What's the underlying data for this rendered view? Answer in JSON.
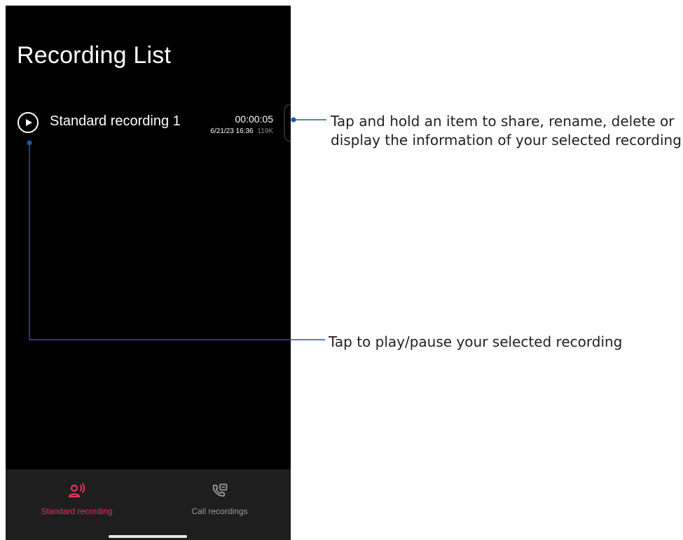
{
  "app": {
    "title": "Recording List"
  },
  "recordings": [
    {
      "name": "Standard recording 1",
      "duration": "00:00:05",
      "date": "6/21/23 16:36",
      "size": "119K"
    }
  ],
  "bottom_nav": {
    "items": [
      {
        "label": "Standard recording",
        "icon": "voice-person-icon",
        "active": true
      },
      {
        "label": "Call recordings",
        "icon": "call-recording-icon",
        "active": false
      }
    ]
  },
  "callouts": {
    "item_hold": {
      "line1": "Tap and hold an item to share, rename, delete or",
      "line2": "display the information of your selected recording"
    },
    "play": "Tap to play/pause your selected recording"
  },
  "colors": {
    "accent": "#e8315b",
    "callout_line": "#1b5aa6",
    "background": "#000000",
    "nav_background": "#1e1e1e"
  }
}
